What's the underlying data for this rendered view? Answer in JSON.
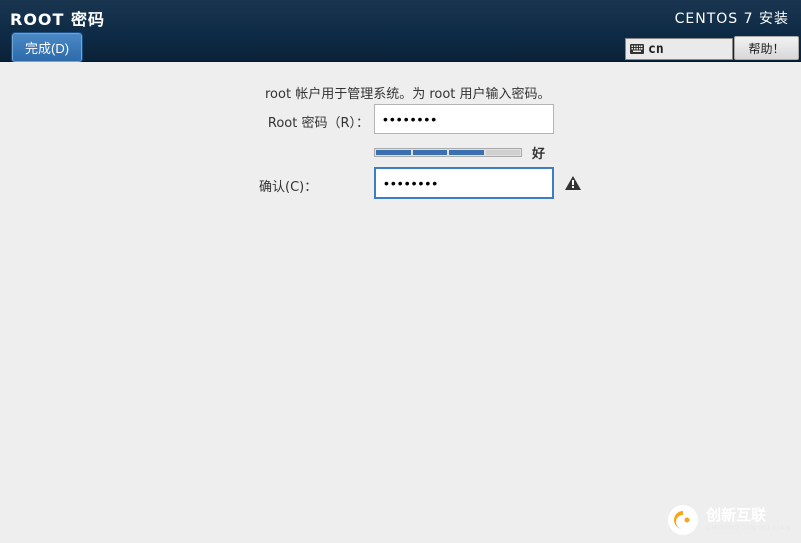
{
  "header": {
    "title": "ROOT 密码",
    "done_label": "完成(D)",
    "installer_title": "CENTOS 7 安装",
    "keyboard_layout": "cn",
    "help_label": "帮助！"
  },
  "form": {
    "description": "root 帐户用于管理系统。为 root 用户输入密码。",
    "password_label": "Root 密码（R）：",
    "password_value": "••••••••",
    "strength_level": 3,
    "strength_text": "好",
    "confirm_label": "确认(C)：",
    "confirm_value": "••••••••",
    "confirm_has_warning": true
  },
  "watermark": {
    "brand_cn": "创新互联",
    "brand_en": "CHUANG XIN HU LIAN"
  }
}
